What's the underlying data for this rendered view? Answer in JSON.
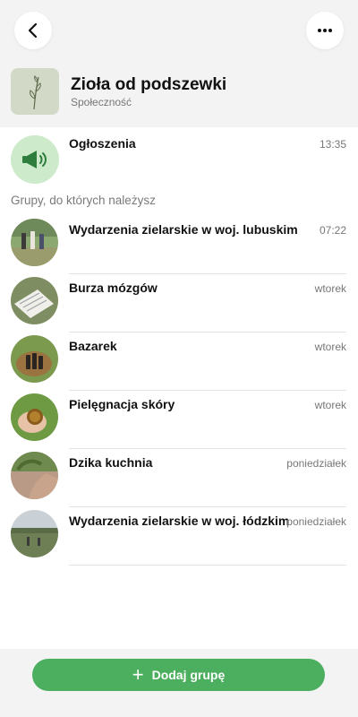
{
  "header": {
    "back_icon": "chevron-left-icon",
    "more_icon": "more-horizontal-icon",
    "title": "Zioła od podszewki",
    "subtitle": "Społeczność"
  },
  "announcements": {
    "icon": "megaphone-icon",
    "title": "Ogłoszenia",
    "time": "13:35"
  },
  "section_label": "Grupy, do których należysz",
  "groups": [
    {
      "title": "Wydarzenia zielarskie w woj. lubuskim",
      "time": "07:22"
    },
    {
      "title": "Burza mózgów",
      "time": "wtorek"
    },
    {
      "title": "Bazarek",
      "time": "wtorek"
    },
    {
      "title": "Pielęgnacja skóry",
      "time": "wtorek"
    },
    {
      "title": "Dzika kuchnia",
      "time": "poniedziałek"
    },
    {
      "title": "Wydarzenia zielarskie w woj. łódzkim",
      "time": "poniedziałek"
    }
  ],
  "footer": {
    "add_label": "Dodaj grupę",
    "add_icon": "plus-icon"
  },
  "colors": {
    "accent_green": "#4caf5f",
    "announce_bg": "#cdebcb",
    "announce_icon": "#2f7d3c",
    "header_bg": "#f3f3f3"
  }
}
